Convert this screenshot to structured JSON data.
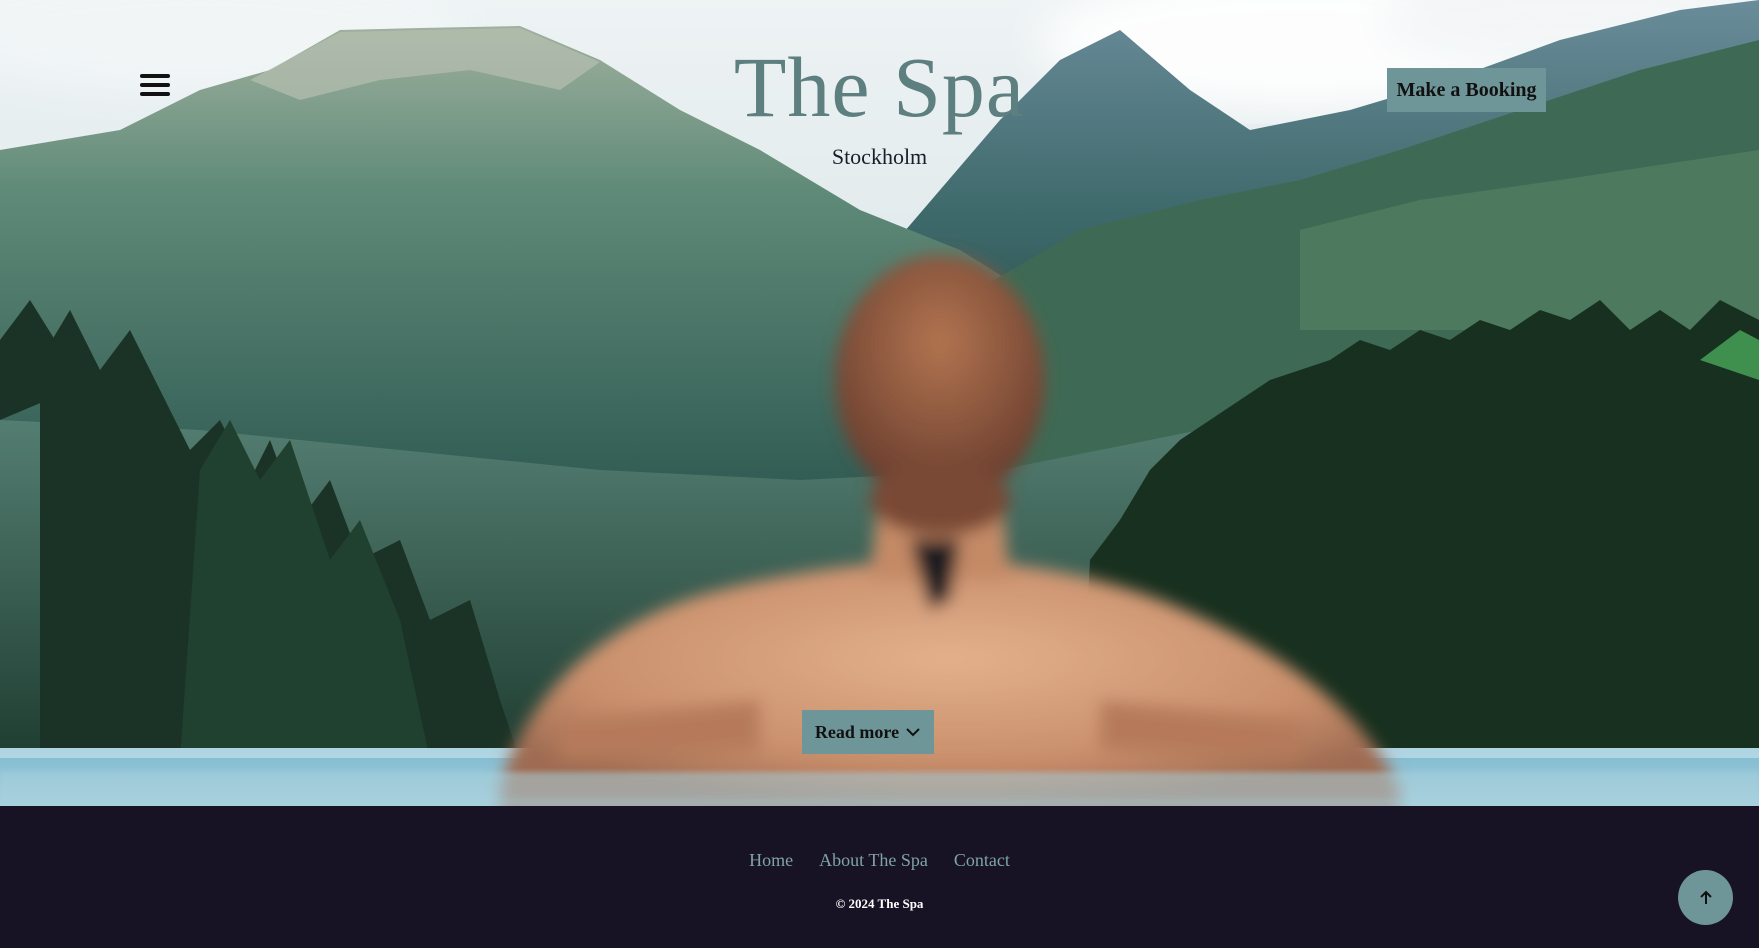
{
  "header": {
    "menu_icon": "hamburger-menu-icon",
    "title": "The Spa",
    "subtitle": "Stockholm",
    "booking_label": "Make a Booking"
  },
  "hero": {
    "read_more_label": "Read more",
    "read_more_icon": "chevron-down-icon"
  },
  "footer": {
    "nav": [
      {
        "label": "Home"
      },
      {
        "label": "About The Spa"
      },
      {
        "label": "Contact"
      }
    ],
    "copyright": "© 2024 The Spa",
    "scroll_top_icon": "arrow-up-icon"
  },
  "colors": {
    "accent": "#6e9598",
    "title": "#5e7f80",
    "footer_bg": "#171324",
    "footer_link": "#7fa3a6"
  }
}
